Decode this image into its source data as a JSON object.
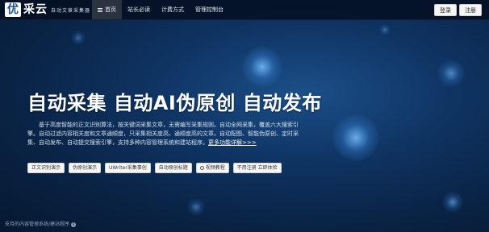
{
  "header": {
    "logo_badge": "优",
    "logo_name": "采云",
    "slogan": "自动文章采集器",
    "nav": [
      {
        "label": "首页",
        "active": true,
        "icon": "menu-icon"
      },
      {
        "label": "站长必读",
        "active": false
      },
      {
        "label": "计费方式",
        "active": false
      },
      {
        "label": "管理控制台",
        "active": false
      }
    ],
    "login_label": "登录",
    "register_label": "注册"
  },
  "hero": {
    "headline": "自动采集 自动AI伪原创 自动发布",
    "description": "基于高度智能的正文识别算法，按关键词采集文章，无需编写采集规则。自动全网采集，覆盖六大搜索引擎。自动过滤内容相关度和文章通顺度，只采集相关度高、通顺度高的文章。自动配图、智能伪原创、定时采集、自动发布、自动提交搜索引擎，支持多种内容管理系统和建站程序。",
    "more_link": "更多功能详解>>>"
  },
  "tags": [
    {
      "label": "正文识别演示"
    },
    {
      "label": "伪原创演示"
    },
    {
      "label": "UWriter采集事创"
    },
    {
      "label": "自动原创标题"
    },
    {
      "label": "视频教程",
      "icon": "play-circle-icon"
    },
    {
      "label": "不用注册 立即体验"
    }
  ],
  "footer": {
    "note": "支持的内容管理系统/建站程序",
    "info_icon": "i"
  },
  "colors": {
    "background": "#0a2447",
    "navbar": "#040e20",
    "nav_active": "#2b3240"
  }
}
